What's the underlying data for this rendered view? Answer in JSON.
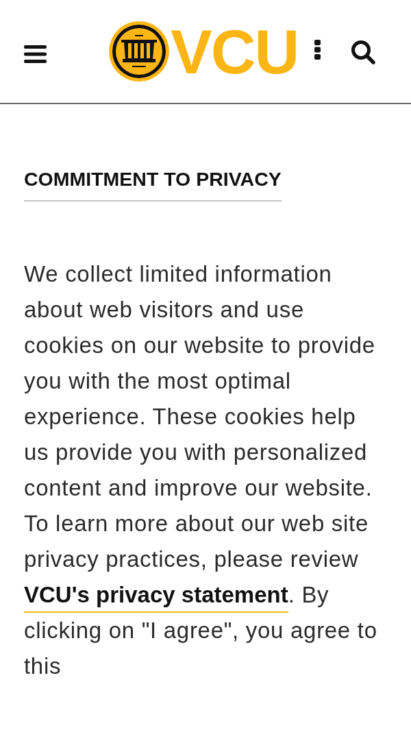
{
  "header": {
    "logo_text": "VCU"
  },
  "section": {
    "heading": "COMMITMENT TO PRIVACY",
    "paragraph": {
      "before": "We collect limited information about web visitors and use cookies on our website to provide you with the most optimal experience. These cookies help us provide you with personalized content and improve our website. To learn more about our web site privacy practices, please review ",
      "link": "VCU's privacy statement",
      "after": ". By clicking on \"I agree\", you agree to this"
    }
  }
}
